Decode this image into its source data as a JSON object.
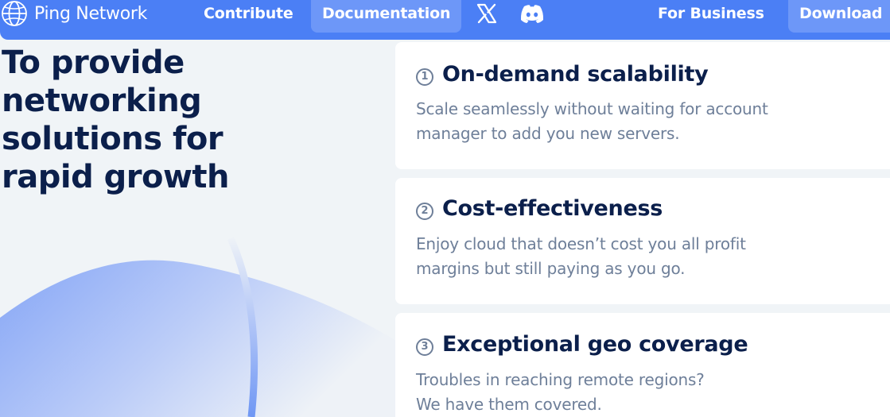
{
  "nav": {
    "brand": "Ping Network",
    "links": [
      "Contribute",
      "Documentation",
      "For Business",
      "Download"
    ],
    "icons": [
      "x-icon",
      "discord-icon",
      "globe-icon"
    ]
  },
  "hero": {
    "title_lines": [
      "To provide",
      "networking",
      "solutions for",
      "rapid growth"
    ]
  },
  "features": [
    {
      "number": "1",
      "title": "On-demand scalability",
      "lines": [
        "Scale seamlessly without waiting for account",
        "manager to add you new servers."
      ]
    },
    {
      "number": "2",
      "title": "Cost-effectiveness",
      "lines": [
        "Enjoy cloud that doesn’t cost you all profit",
        "margins but still paying as you go."
      ]
    },
    {
      "number": "3",
      "title": "Exceptional geo coverage",
      "lines": [
        "Troubles in reaching remote regions?",
        "We have them covered."
      ]
    }
  ],
  "colors": {
    "nav_bg": "#4b7ff5",
    "nav_pill": "#6d97f8",
    "page_bg": "#f0f4f7",
    "heading": "#0b1f4b",
    "muted": "#6e7f99"
  }
}
